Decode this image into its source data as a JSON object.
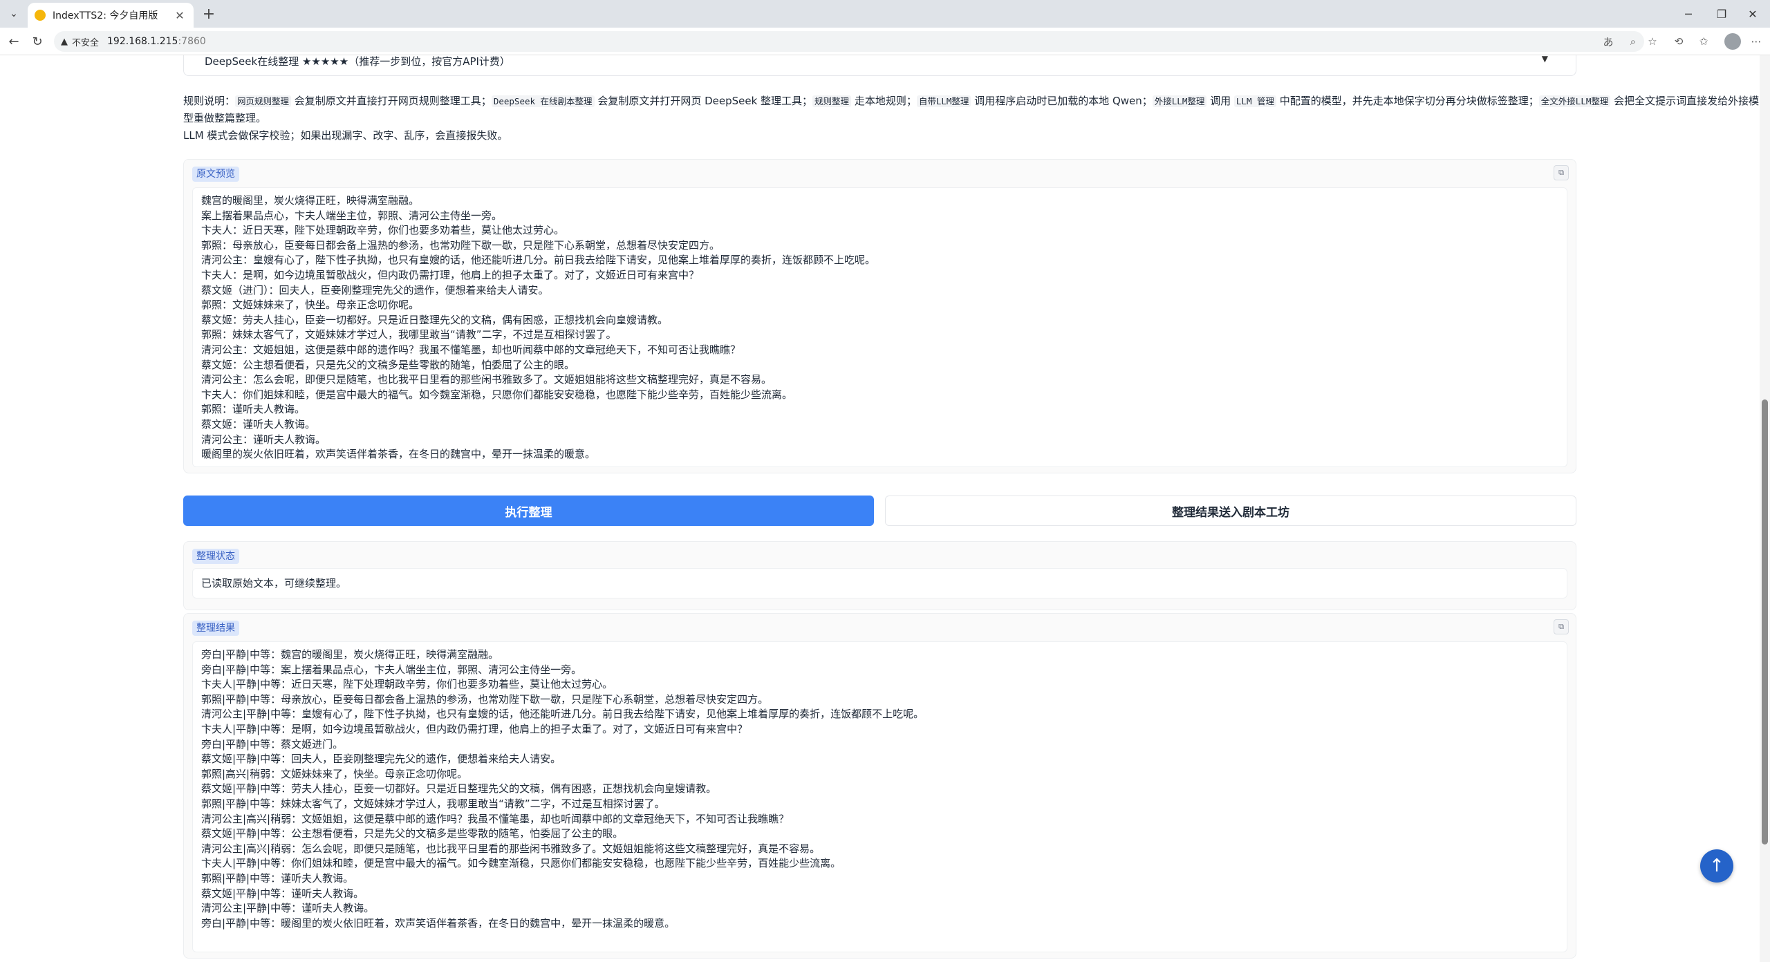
{
  "browser": {
    "tab_title": "IndexTTS2: 今夕自用版",
    "insecure_label": "不安全",
    "url_host": "192.168.1.215",
    "url_port": ":7860"
  },
  "dropdown": {
    "selected": "DeepSeek在线整理 ★★★★★（推荐一步到位，按官方API计费）"
  },
  "rules": {
    "prefix": "规则说明：",
    "code1": "网页规则整理",
    "t1": " 会复制原文并直接打开网页规则整理工具；",
    "code2": "DeepSeek 在线剧本整理",
    "t2": " 会复制原文并打开网页 DeepSeek 整理工具；",
    "code3": "规则整理",
    "t3": " 走本地规则；",
    "code4": "自带LLM整理",
    "t4": " 调用程序启动时已加载的本地 Qwen；",
    "code5": "外接LLM整理",
    "t5": " 调用 ",
    "code6": "LLM 管理",
    "t6": " 中配置的模型，并先走本地保字切分再分块做标签整理；",
    "code7": "全文外接LLM整理",
    "t7": " 会把全文提示词直接发给外接模型重做整篇整理。",
    "line2": "LLM 模式会做保字校验；如果出现漏字、改字、乱序，会直接报失败。"
  },
  "source_preview": {
    "label": "原文预览",
    "lines": [
      "魏宫的暖阁里，炭火烧得正旺，映得满室融融。",
      "案上摆着果品点心，卞夫人端坐主位，郭照、清河公主侍坐一旁。",
      "卞夫人：近日天寒，陛下处理朝政辛劳，你们也要多劝着些，莫让他太过劳心。",
      "郭照：母亲放心，臣妾每日都会备上温热的参汤，也常劝陛下歇一歇，只是陛下心系朝堂，总想着尽快安定四方。",
      "清河公主：皇嫂有心了，陛下性子执拗，也只有皇嫂的话，他还能听进几分。前日我去给陛下请安，见他案上堆着厚厚的奏折，连饭都顾不上吃呢。",
      "卞夫人：是啊，如今边境虽暂歇战火，但内政仍需打理，他肩上的担子太重了。对了，文姬近日可有来宫中？",
      "蔡文姬（进门）：回夫人，臣妾刚整理完先父的遗作，便想着来给夫人请安。",
      "郭照：文姬妹妹来了，快坐。母亲正念叨你呢。",
      "蔡文姬：劳夫人挂心，臣妾一切都好。只是近日整理先父的文稿，偶有困惑，正想找机会向皇嫂请教。",
      "郭照：妹妹太客气了，文姬妹妹才学过人，我哪里敢当“请教”二字，不过是互相探讨罢了。",
      "清河公主：文姬姐姐，这便是蔡中郎的遗作吗？我虽不懂笔墨，却也听闻蔡中郎的文章冠绝天下，不知可否让我瞧瞧？",
      "蔡文姬：公主想看便看，只是先父的文稿多是些零散的随笔，怕委屈了公主的眼。",
      "清河公主：怎么会呢，即便只是随笔，也比我平日里看的那些闲书雅致多了。文姬姐姐能将这些文稿整理完好，真是不容易。",
      "卞夫人：你们姐妹和睦，便是宫中最大的福气。如今魏室渐稳，只愿你们都能安安稳稳，也愿陛下能少些辛劳，百姓能少些流离。",
      "郭照：谨听夫人教诲。",
      "蔡文姬：谨听夫人教诲。",
      "清河公主：谨听夫人教诲。",
      "暖阁里的炭火依旧旺着，欢声笑语伴着茶香，在冬日的魏宫中，晕开一抹温柔的暖意。"
    ]
  },
  "actions": {
    "run_label": "执行整理",
    "send_label": "整理结果送入剧本工坊"
  },
  "status": {
    "label": "整理状态",
    "text": "已读取原始文本，可继续整理。"
  },
  "result": {
    "label": "整理结果",
    "lines": [
      "旁白|平静|中等：魏宫的暖阁里，炭火烧得正旺，映得满室融融。",
      "旁白|平静|中等：案上摆着果品点心，卞夫人端坐主位，郭照、清河公主侍坐一旁。",
      "卞夫人|平静|中等：近日天寒，陛下处理朝政辛劳，你们也要多劝着些，莫让他太过劳心。",
      "郭照|平静|中等：母亲放心，臣妾每日都会备上温热的参汤，也常劝陛下歇一歇，只是陛下心系朝堂，总想着尽快安定四方。",
      "清河公主|平静|中等：皇嫂有心了，陛下性子执拗，也只有皇嫂的话，他还能听进几分。前日我去给陛下请安，见他案上堆着厚厚的奏折，连饭都顾不上吃呢。",
      "卞夫人|平静|中等：是啊，如今边境虽暂歇战火，但内政仍需打理，他肩上的担子太重了。对了，文姬近日可有来宫中？",
      "旁白|平静|中等：蔡文姬进门。",
      "蔡文姬|平静|中等：回夫人，臣妾刚整理完先父的遗作，便想着来给夫人请安。",
      "郭照|高兴|稍弱：文姬妹妹来了，快坐。母亲正念叨你呢。",
      "蔡文姬|平静|中等：劳夫人挂心，臣妾一切都好。只是近日整理先父的文稿，偶有困惑，正想找机会向皇嫂请教。",
      "郭照|平静|中等：妹妹太客气了，文姬妹妹才学过人，我哪里敢当“请教”二字，不过是互相探讨罢了。",
      "清河公主|高兴|稍弱：文姬姐姐，这便是蔡中郎的遗作吗？我虽不懂笔墨，却也听闻蔡中郎的文章冠绝天下，不知可否让我瞧瞧？",
      "蔡文姬|平静|中等：公主想看便看，只是先父的文稿多是些零散的随笔，怕委屈了公主的眼。",
      "清河公主|高兴|稍弱：怎么会呢，即便只是随笔，也比我平日里看的那些闲书雅致多了。文姬姐姐能将这些文稿整理完好，真是不容易。",
      "卞夫人|平静|中等：你们姐妹和睦，便是宫中最大的福气。如今魏室渐稳，只愿你们都能安安稳稳，也愿陛下能少些辛劳，百姓能少些流离。",
      "郭照|平静|中等：谨听夫人教诲。",
      "蔡文姬|平静|中等：谨听夫人教诲。",
      "清河公主|平静|中等：谨听夫人教诲。",
      "旁白|平静|中等：暖阁里的炭火依旧旺着，欢声笑语伴着茶香，在冬日的魏宫中，晕开一抹温柔的暖意。"
    ]
  }
}
